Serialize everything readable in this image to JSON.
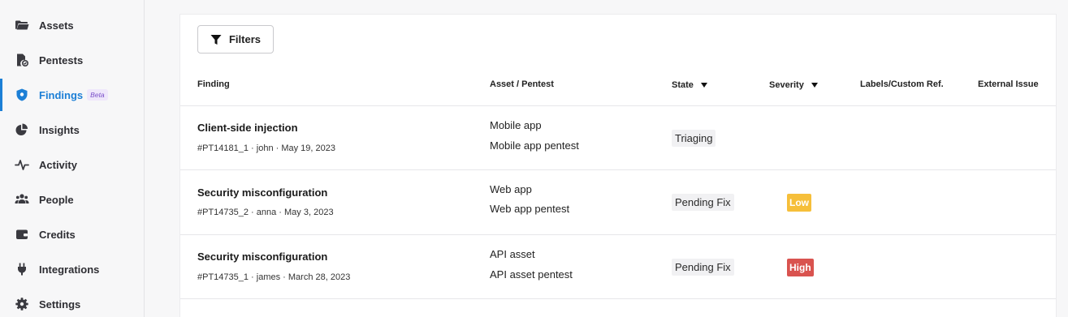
{
  "sidebar": {
    "items": [
      {
        "label": "Assets"
      },
      {
        "label": "Pentests"
      },
      {
        "label": "Findings",
        "badge": "Beta"
      },
      {
        "label": "Insights"
      },
      {
        "label": "Activity"
      },
      {
        "label": "People"
      },
      {
        "label": "Credits"
      },
      {
        "label": "Integrations"
      },
      {
        "label": "Settings"
      }
    ]
  },
  "toolbar": {
    "filters_label": "Filters"
  },
  "table": {
    "columns": {
      "finding": "Finding",
      "asset": "Asset / Pentest",
      "state": "State",
      "severity": "Severity",
      "labels": "Labels/Custom Ref.",
      "external": "External Issue"
    },
    "rows": [
      {
        "title": "Client-side injection",
        "meta": "#PT14181_1 · john · May 19, 2023",
        "asset": "Mobile app",
        "pentest": "Mobile app pentest",
        "state": "Triaging",
        "severity": ""
      },
      {
        "title": "Security misconfiguration",
        "meta": "#PT14735_2 · anna · May 3, 2023",
        "asset": "Web app",
        "pentest": "Web app pentest",
        "state": "Pending Fix",
        "severity": "Low"
      },
      {
        "title": "Security misconfiguration",
        "meta": "#PT14735_1 · james · March 28, 2023",
        "asset": "API asset",
        "pentest": "API asset pentest",
        "state": "Pending Fix",
        "severity": "High"
      }
    ]
  },
  "colors": {
    "accent": "#1c7fd6",
    "low": "#f6bf3a",
    "high": "#d9534f"
  }
}
